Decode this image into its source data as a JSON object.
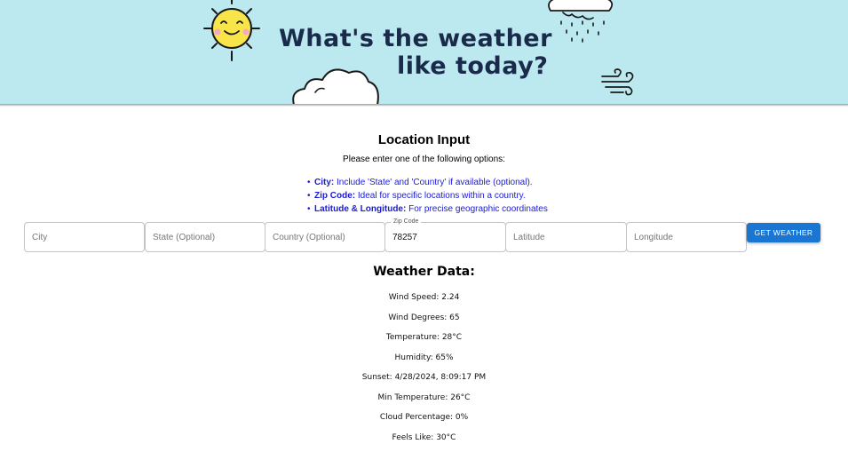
{
  "banner": {
    "title_line1": "What's the weather",
    "title_line2": "like today?"
  },
  "icons": [
    "sun-icon",
    "cloud-icon",
    "rain-cloud-icon",
    "wind-icon"
  ],
  "colors": {
    "banner_bg": "#bce8ef",
    "title_color": "#1a2a4a",
    "option_text": "#1a1adc",
    "button_bg": "#1976d2"
  },
  "location": {
    "heading": "Location Input",
    "instructions": "Please enter one of the following options:",
    "options": [
      {
        "term": "City:",
        "text": " Include 'State' and 'Country' if available (optional)."
      },
      {
        "term": "Zip Code:",
        "text": " Ideal for specific locations within a country."
      },
      {
        "term": "Latitude & Longitude:",
        "text": " For precise geographic coordinates"
      }
    ],
    "fields": {
      "city_placeholder": "City",
      "state_placeholder": "State (Optional)",
      "country_placeholder": "Country (Optional)",
      "zip_label": "Zip Code",
      "zip_value": "78257",
      "latitude_placeholder": "Latitude",
      "longitude_placeholder": "Longitude"
    },
    "button_label": "GET WEATHER"
  },
  "weather": {
    "heading": "Weather Data:",
    "rows": [
      "Wind Speed: 2.24",
      "Wind Degrees: 65",
      "Temperature: 28°C",
      "Humidity: 65%",
      "Sunset: 4/28/2024, 8:09:17 PM",
      "Min Temperature: 26°C",
      "Cloud Percentage: 0%",
      "Feels Like: 30°C"
    ]
  }
}
